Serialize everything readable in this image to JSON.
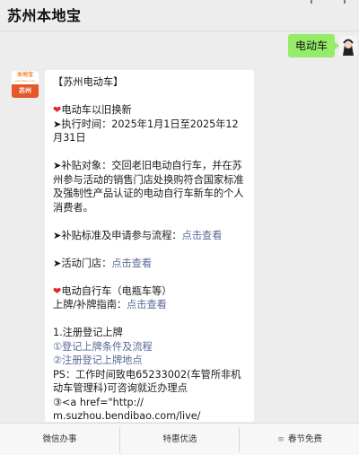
{
  "header": {
    "title": "苏州本地宝"
  },
  "outgoing": {
    "text": "电动车"
  },
  "account_avatar": {
    "top": "本地宝",
    "sub": "bendibao.com",
    "bottom": "苏州"
  },
  "message": {
    "lines": [
      "【苏州电动车】",
      "",
      "电动车以旧换新",
      "➤执行时间：2025年1月1日至2025年12月31日",
      "",
      "➤补贴对象：交回老旧电动自行车，并在苏州参与活动的销售门店处换购符合国家标准及强制性产品认证的电动自行车新车的个人消费者。",
      "",
      "➤补贴标准及申请参与流程：",
      "",
      "➤活动门店：",
      "",
      "电动自行车（电瓶车等）",
      "上牌/补牌指南：",
      "",
      "1.注册登记上牌",
      "①登记上牌条件及流程",
      "②注册登记上牌地点",
      "PS：工作时间致电65233002(车管所非机动车管理科)可咨询就近办理点",
      "③<a href=\"http://",
      "m.suzhou.bendibao.com/live/"
    ],
    "link_text": "点击查看"
  },
  "tabs": [
    {
      "label": "微信办事"
    },
    {
      "label": "特惠优选"
    },
    {
      "label": "春节免费",
      "icon": "menu-icon"
    }
  ]
}
